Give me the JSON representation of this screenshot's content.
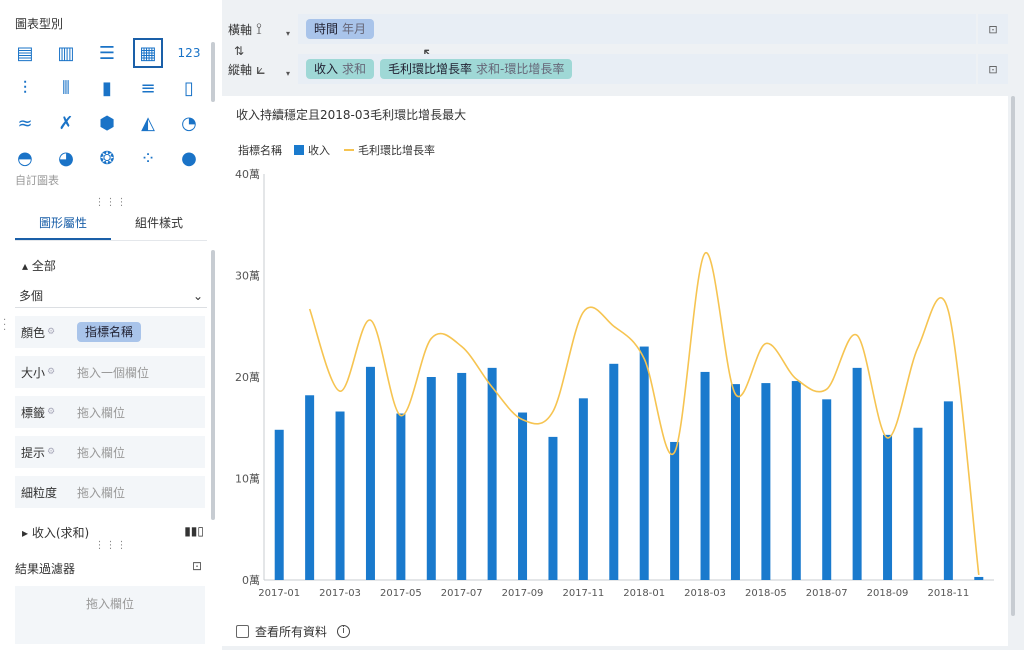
{
  "left_panel": {
    "chart_type_title": "圖表型別",
    "custom_chart_label": "自訂圖表",
    "chart_type_icons": [
      {
        "icon": "table-icon",
        "glyph": "▤"
      },
      {
        "icon": "cross-table-icon",
        "glyph": "▥"
      },
      {
        "icon": "detail-table-icon",
        "glyph": "☰"
      },
      {
        "icon": "grouped-table-icon",
        "glyph": "▦",
        "selected": true
      },
      {
        "icon": "kpi-number-icon",
        "glyph": "123"
      },
      {
        "icon": "bar-group-icon",
        "glyph": "⫶"
      },
      {
        "icon": "stacked-bar-icon",
        "glyph": "⦀"
      },
      {
        "icon": "column-chart-icon",
        "glyph": "▮"
      },
      {
        "icon": "horizontal-bar-icon",
        "glyph": "≡"
      },
      {
        "icon": "waterfall-icon",
        "glyph": "▯"
      },
      {
        "icon": "line-chart-icon",
        "glyph": "≈"
      },
      {
        "icon": "line-scatter-icon",
        "glyph": "✗"
      },
      {
        "icon": "radar-icon",
        "glyph": "⬢"
      },
      {
        "icon": "area-chart-icon",
        "glyph": "◭"
      },
      {
        "icon": "gauge-icon",
        "glyph": "◔"
      },
      {
        "icon": "half-pie-icon",
        "glyph": "◓"
      },
      {
        "icon": "pie-chart-icon",
        "glyph": "◕"
      },
      {
        "icon": "rose-chart-icon",
        "glyph": "❂"
      },
      {
        "icon": "scatter-icon",
        "glyph": "⁘"
      },
      {
        "icon": "bubble-icon",
        "glyph": "●"
      }
    ],
    "tabs": {
      "graph_props": "圖形屬性",
      "component_style": "組件樣式"
    },
    "all_label": "▴ 全部",
    "dropdown_value": "多個",
    "fields": {
      "color_label": "顏色",
      "color_value": "指標名稱",
      "size_label": "大小",
      "size_placeholder": "拖入一個欄位",
      "label_label": "標籤",
      "label_placeholder": "拖入欄位",
      "tooltip_label": "提示",
      "tooltip_placeholder": "拖入欄位",
      "granularity_label": "細粒度",
      "granularity_placeholder": "拖入欄位"
    },
    "measure_row": "▸ 收入(求和)",
    "filter_title": "結果過濾器",
    "filter_placeholder": "拖入欄位"
  },
  "axes": {
    "x_name": "橫軸",
    "x_field": "時間",
    "x_field_sub": "年月",
    "y_name": "縱軸",
    "y_field1": "收入",
    "y_field1_sub": "求和",
    "y_field2": "毛利環比增長率",
    "y_field2_sub": "求和-環比增長率"
  },
  "card": {
    "title": "收入持續穩定且2018-03毛利環比增長最大",
    "legend_title": "指標名稱",
    "legend_series1": "收入",
    "legend_series2": "毛利環比增長率",
    "footer_label": "查看所有資料",
    "info_glyph": "i"
  },
  "colors": {
    "bar": "#1a7acd",
    "line": "#f6c451",
    "accent": "#1a5fa8"
  },
  "chart_data": {
    "type": "bar",
    "categories": [
      "2017-01",
      "2017-02",
      "2017-03",
      "2017-04",
      "2017-05",
      "2017-06",
      "2017-07",
      "2017-08",
      "2017-09",
      "2017-10",
      "2017-11",
      "2017-12",
      "2018-01",
      "2018-02",
      "2018-03",
      "2018-04",
      "2018-05",
      "2018-06",
      "2018-07",
      "2018-08",
      "2018-09",
      "2018-10",
      "2018-11",
      "2018-12"
    ],
    "x_tick_labels": [
      "2017-01",
      "",
      "2017-03",
      "",
      "2017-05",
      "",
      "2017-07",
      "",
      "2017-09",
      "",
      "2017-11",
      "",
      "2018-01",
      "",
      "2018-03",
      "",
      "2018-05",
      "",
      "2018-07",
      "",
      "2018-09",
      "",
      "2018-11",
      ""
    ],
    "y_ticks": [
      "0萬",
      "10萬",
      "20萬",
      "30萬",
      "40萬"
    ],
    "ylim": [
      0,
      400000
    ],
    "series": [
      {
        "name": "收入",
        "type": "bar",
        "values": [
          148000,
          182000,
          166000,
          210000,
          164000,
          200000,
          204000,
          209000,
          165000,
          141000,
          179000,
          213000,
          230000,
          136000,
          205000,
          193000,
          194000,
          196000,
          178000,
          209000,
          143000,
          150000,
          176000,
          3000
        ]
      },
      {
        "name": "毛利環比增長率",
        "type": "line",
        "values": [
          null,
          267000,
          186000,
          256000,
          162000,
          238000,
          230000,
          190000,
          158000,
          166000,
          264000,
          250000,
          218000,
          126000,
          322000,
          183000,
          233000,
          198000,
          188000,
          241000,
          140000,
          229000,
          265000,
          5000
        ]
      }
    ]
  }
}
